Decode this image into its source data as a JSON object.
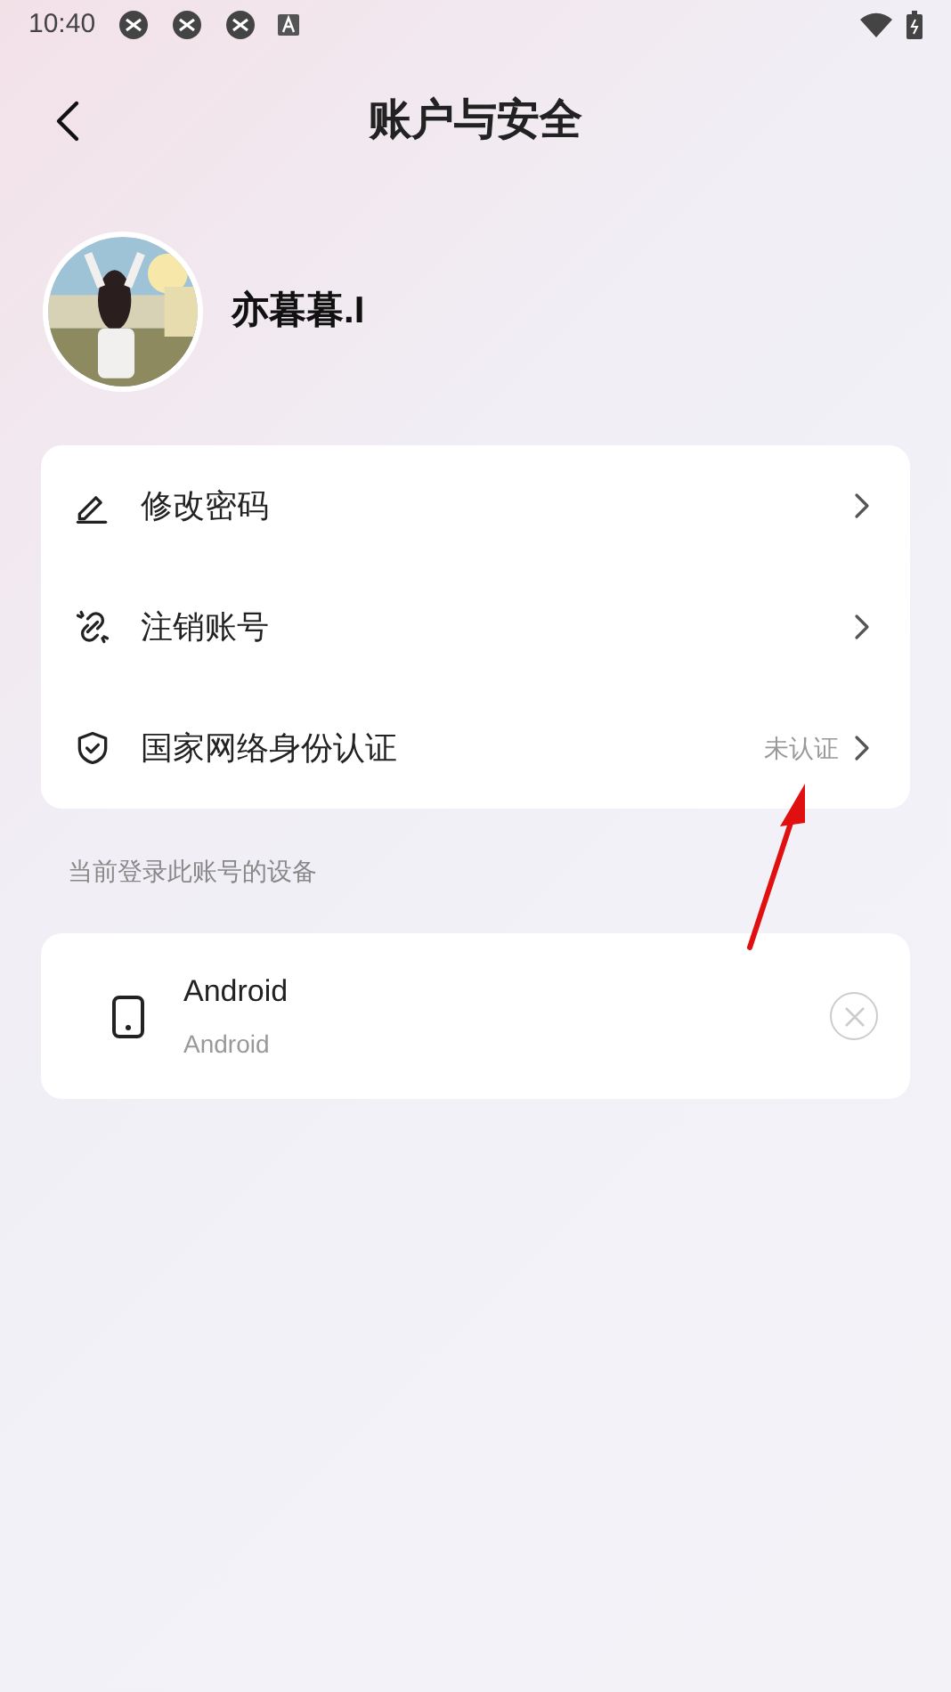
{
  "status_bar": {
    "time": "10:40"
  },
  "header": {
    "title": "账户与安全"
  },
  "profile": {
    "name": "亦暮暮.I"
  },
  "menu": [
    {
      "kind": "pencil",
      "label": "修改密码"
    },
    {
      "kind": "unlink",
      "label": "注销账号"
    },
    {
      "kind": "shield",
      "label": "国家网络身份认证",
      "status": "未认证"
    }
  ],
  "devices_section": {
    "label": "当前登录此账号的设备"
  },
  "devices": [
    {
      "name": "Android",
      "subtitle": "Android"
    }
  ]
}
